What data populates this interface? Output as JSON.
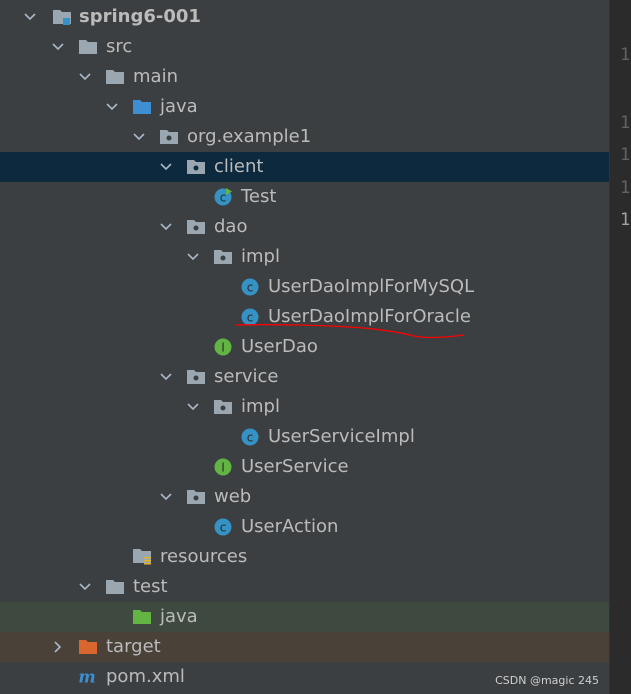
{
  "project_tree": {
    "nodes": [
      {
        "label": "spring6-001",
        "icon": "module-folder-icon",
        "expanded": true
      },
      {
        "label": "src",
        "icon": "folder-icon",
        "expanded": true
      },
      {
        "label": "main",
        "icon": "folder-icon",
        "expanded": true
      },
      {
        "label": "java",
        "icon": "source-root-folder-icon",
        "expanded": true
      },
      {
        "label": "org.example1",
        "icon": "package-icon",
        "expanded": true
      },
      {
        "label": "client",
        "icon": "package-icon",
        "expanded": true,
        "selected": true
      },
      {
        "label": "Test",
        "icon": "runnable-class-icon"
      },
      {
        "label": "dao",
        "icon": "package-icon",
        "expanded": true
      },
      {
        "label": "impl",
        "icon": "package-icon",
        "expanded": true
      },
      {
        "label": "UserDaoImplForMySQL",
        "icon": "class-icon"
      },
      {
        "label": "UserDaoImplForOracle",
        "icon": "class-icon",
        "annotated": "red-underline"
      },
      {
        "label": "UserDao",
        "icon": "interface-icon"
      },
      {
        "label": "service",
        "icon": "package-icon",
        "expanded": true
      },
      {
        "label": "impl",
        "icon": "package-icon",
        "expanded": true
      },
      {
        "label": "UserServiceImpl",
        "icon": "class-icon"
      },
      {
        "label": "UserService",
        "icon": "interface-icon"
      },
      {
        "label": "web",
        "icon": "package-icon",
        "expanded": true
      },
      {
        "label": "UserAction",
        "icon": "class-icon"
      },
      {
        "label": "resources",
        "icon": "resources-folder-icon"
      },
      {
        "label": "test",
        "icon": "folder-icon",
        "expanded": true
      },
      {
        "label": "java",
        "icon": "test-source-folder-icon"
      },
      {
        "label": "target",
        "icon": "excluded-folder-icon",
        "expanded": false
      },
      {
        "label": "pom.xml",
        "icon": "maven-icon"
      }
    ]
  },
  "editor_gutter": {
    "line_numbers": [
      "1",
      "1",
      "1",
      "1",
      "1"
    ]
  },
  "watermark": "CSDN @magic 245",
  "colors": {
    "background": "#3c3f41",
    "selected_row": "#0d293e",
    "test_source_row": "#3e4a3f",
    "excluded_row": "#4a4138",
    "text": "#bbbbbb",
    "folder": "#9aa7b0",
    "source_root": "#3d8fd1",
    "test_root": "#62b543",
    "excluded": "#d9652f",
    "class_icon": "#3592c4",
    "interface_icon": "#62b543",
    "annotation": "#ff0000"
  }
}
